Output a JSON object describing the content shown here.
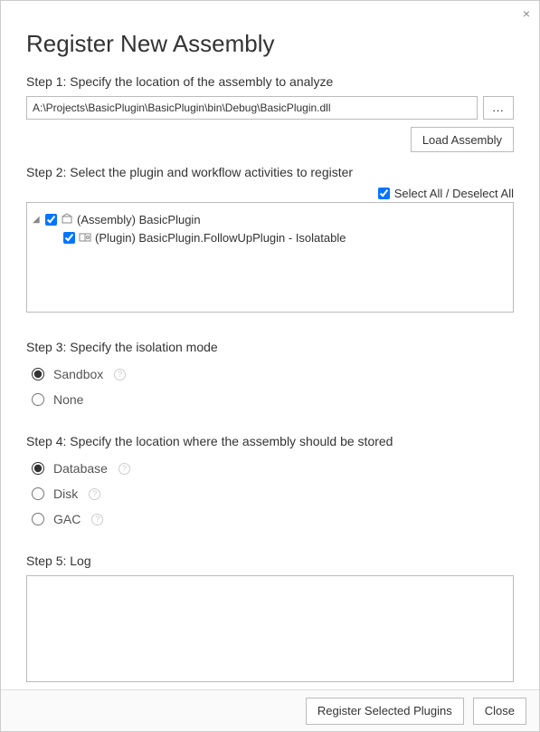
{
  "title": "Register New Assembly",
  "close_glyph": "×",
  "step1": {
    "label": "Step 1: Specify the location of the assembly to analyze",
    "path": "A:\\Projects\\BasicPlugin\\BasicPlugin\\bin\\Debug\\BasicPlugin.dll",
    "browse_label": "...",
    "load_button": "Load Assembly"
  },
  "step2": {
    "label": "Step 2: Select the plugin and workflow activities to register",
    "select_all_label": "Select All / Deselect All",
    "select_all_checked": true,
    "tree": {
      "assembly_label": "(Assembly) BasicPlugin",
      "assembly_checked": true,
      "plugin_label": "(Plugin) BasicPlugin.FollowUpPlugin - Isolatable",
      "plugin_checked": true
    }
  },
  "step3": {
    "label": "Step 3: Specify the isolation mode",
    "options": {
      "sandbox": "Sandbox",
      "none": "None"
    },
    "selected": "sandbox"
  },
  "step4": {
    "label": "Step 4: Specify the location where the assembly should be stored",
    "options": {
      "database": "Database",
      "disk": "Disk",
      "gac": "GAC"
    },
    "selected": "database"
  },
  "step5": {
    "label": "Step 5: Log",
    "content": ""
  },
  "footer": {
    "register_button": "Register Selected Plugins",
    "close_button": "Close"
  }
}
